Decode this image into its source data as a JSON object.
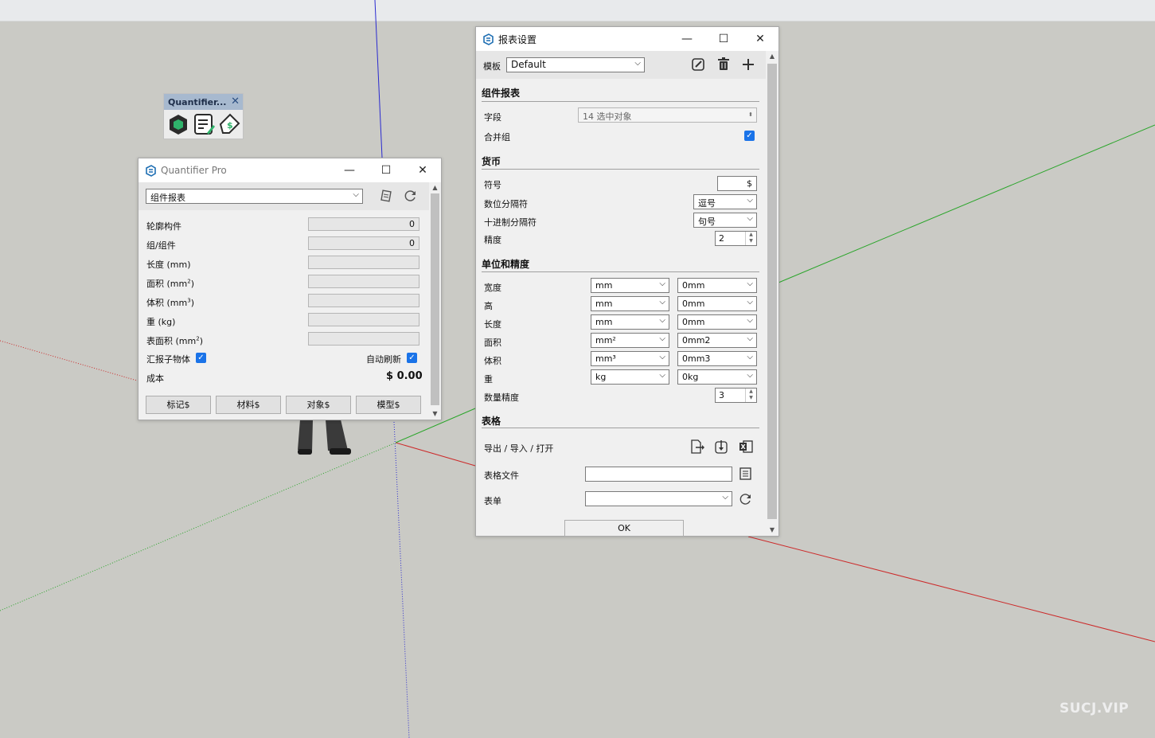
{
  "mini_toolbar": {
    "title": "Quantifier...",
    "close": "✕"
  },
  "quantifier": {
    "title": "Quantifier Pro",
    "report_select": "组件报表",
    "rows": [
      {
        "label": "轮廓构件",
        "value": "0"
      },
      {
        "label": "组/组件",
        "value": "0"
      },
      {
        "label": "长度 (mm)",
        "value": ""
      },
      {
        "label": "面积 (mm",
        "sup": "2",
        "suffix": ")",
        "value": ""
      },
      {
        "label": "体积 (mm",
        "sup": "3",
        "suffix": ")",
        "value": ""
      },
      {
        "label": "重 (kg)",
        "value": ""
      },
      {
        "label": "表面积 (mm",
        "sup": "2",
        "suffix": ")",
        "value": ""
      }
    ],
    "summary_children": "汇报子物体",
    "auto_refresh": "自动刷新",
    "cost_label": "成本",
    "cost_value": "$ 0.00",
    "buttons": [
      "标记$",
      "材料$",
      "对象$",
      "模型$"
    ]
  },
  "settings": {
    "title": "报表设置",
    "template_label": "模板",
    "template_value": "Default",
    "sections": {
      "component_report": "组件报表",
      "currency": "货币",
      "units": "单位和精度",
      "spreadsheet": "表格"
    },
    "fields_label": "字段",
    "fields_value": "14 选中对象",
    "merge_groups": "合并组",
    "symbol_label": "符号",
    "symbol_value": "$",
    "digit_sep_label": "数位分隔符",
    "digit_sep_value": "逗号",
    "decimal_sep_label": "十进制分隔符",
    "decimal_sep_value": "句号",
    "precision_label": "精度",
    "precision_value": "2",
    "unit_rows": [
      {
        "label": "宽度",
        "unit": "mm",
        "precision": "0mm"
      },
      {
        "label": "高",
        "unit": "mm",
        "precision": "0mm"
      },
      {
        "label": "长度",
        "unit": "mm",
        "precision": "0mm"
      },
      {
        "label": "面积",
        "unit": "mm²",
        "precision": "0mm2"
      },
      {
        "label": "体积",
        "unit": "mm³",
        "precision": "0mm3"
      },
      {
        "label": "重",
        "unit": "kg",
        "precision": "0kg"
      }
    ],
    "quantity_precision_label": "数量精度",
    "quantity_precision_value": "3",
    "export_label": "导出 / 导入 / 打开",
    "file_label": "表格文件",
    "file_value": "",
    "sheet_label": "表单",
    "sheet_value": "",
    "ok": "OK"
  },
  "watermark": "SUCJ.VIP",
  "colors": {
    "check": "#1a73e8",
    "axis_blue": "#2a2ad0",
    "axis_red": "#cc2a2a",
    "axis_green": "#2aa52a"
  }
}
